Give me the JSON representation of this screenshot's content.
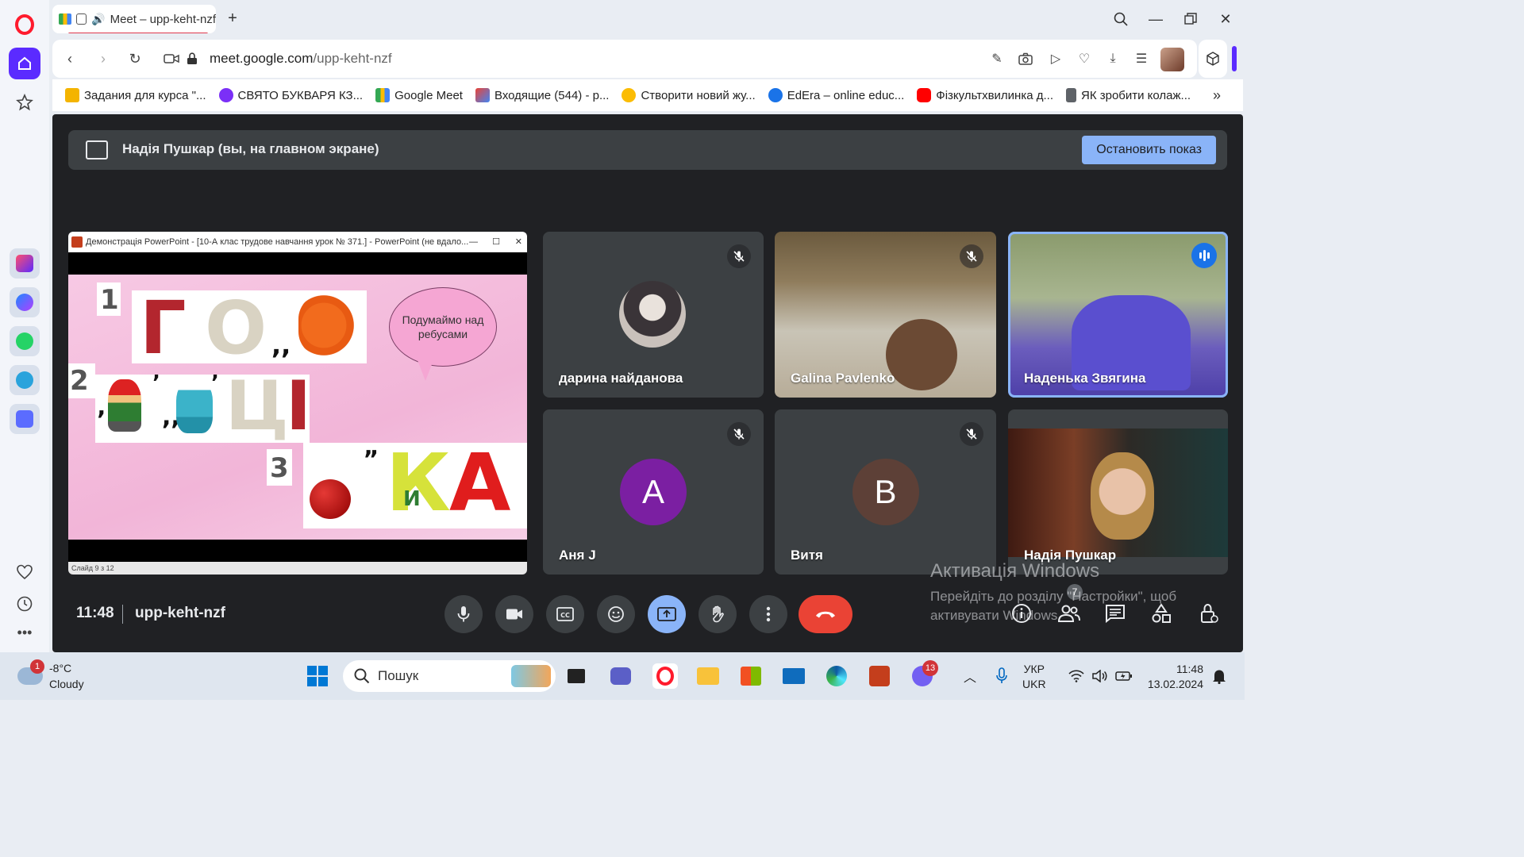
{
  "browser": {
    "tab_title": "Meet – upp-keht-nzf",
    "url_host": "meet.google.com",
    "url_path": "/upp-keht-nzf"
  },
  "bookmarks": [
    {
      "label": "Задания для курса \"...",
      "color": "#f4b400"
    },
    {
      "label": "СВЯТО БУКВАРЯ КЗ...",
      "color": "#7b2ff7"
    },
    {
      "label": "Google Meet",
      "color": "#34a853"
    },
    {
      "label": "Входящие (544) - р...",
      "color": "#ea4335"
    },
    {
      "label": "Створити новий жу...",
      "color": "#fbbc04"
    },
    {
      "label": "EdEra – online educ...",
      "color": "#1a73e8"
    },
    {
      "label": "Фізкультхвилинка д...",
      "color": "#ff0000"
    },
    {
      "label": "ЯК зробити колаж...",
      "color": "#5f6368"
    }
  ],
  "meet": {
    "banner_text": "Надія Пушкар (вы, на главном экране)",
    "stop_button": "Остановить показ",
    "presentation": {
      "window_title": "Демонстрація PowerPoint - [10-А клас трудове навчання урок № 371.] - PowerPoint (не вдало...",
      "bubble_text": "Подумаймо над ребусами",
      "status_text": "Слайд 9 з 12",
      "rebus_numbers": [
        "1",
        "2",
        "3"
      ],
      "rebus_letters_row1": [
        "Г",
        "О"
      ],
      "rebus_letters_row2": [
        "Ц",
        "І"
      ],
      "rebus_letters_row3": [
        "К",
        "А"
      ],
      "rebus_small_letter": "И",
      "marks": [
        ",,",
        "’",
        "’",
        ",,",
        "„"
      ]
    },
    "participants": [
      {
        "name": "дарина найданова",
        "muted": true
      },
      {
        "name": "Galina Pavlenko",
        "muted": true
      },
      {
        "name": "Наденька Звягина",
        "muted": false,
        "speaking": true
      },
      {
        "name": "Аня J",
        "letter": "A",
        "avatar_color": "#7b1fa2",
        "muted": true
      },
      {
        "name": "Витя",
        "letter": "B",
        "avatar_color": "#5d4037",
        "muted": true
      },
      {
        "name": "Надія Пушкар",
        "muted": false
      }
    ],
    "time": "11:48",
    "meeting_code": "upp-keht-nzf",
    "people_count": "7",
    "activation_title": "Активація Windows",
    "activation_line1": "Перейдіть до розділу \"Настройки\", щоб",
    "activation_line2": "активувати Windows."
  },
  "taskbar": {
    "weather_temp": "-8°C",
    "weather_desc": "Cloudy",
    "weather_badge": "1",
    "search_placeholder": "Пошук",
    "viber_badge": "13",
    "lang_top": "УКР",
    "lang_bottom": "UKR",
    "time": "11:48",
    "date": "13.02.2024"
  },
  "colors": {
    "opera_red": "#ff1b2d",
    "opera_purple": "#5b2bff",
    "meet_bg": "#202124",
    "accent_blue": "#8ab4f8",
    "end_call_red": "#ea4335"
  }
}
